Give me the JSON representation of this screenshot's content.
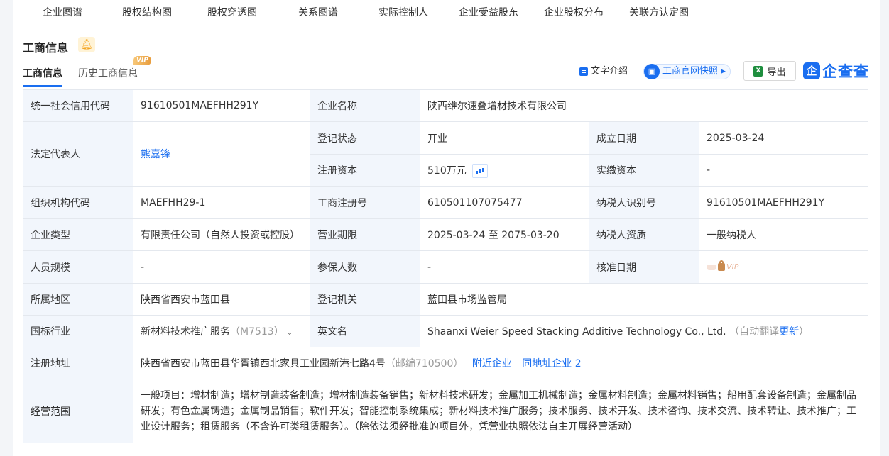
{
  "top_nav": [
    "企业图谱",
    "股权结构图",
    "股权穿透图",
    "关系图谱",
    "实际控制人",
    "企业受益股东",
    "企业股权分布",
    "关联方认定图"
  ],
  "section": {
    "title": "工商信息",
    "bell_icon": "bell-icon"
  },
  "tabs": {
    "active": "工商信息",
    "history": "历史工商信息",
    "vip": "VIP"
  },
  "toolbar": {
    "text_intro": "文字介绍",
    "snapshot": "工商官网快照",
    "export": "导出",
    "brand": "企查查",
    "brand_logo": "企"
  },
  "info": {
    "credit_code_label": "统一社会信用代码",
    "credit_code": "91610501MAEFHH291Y",
    "name_label": "企业名称",
    "name": "陕西维尔速叠增材技术有限公司",
    "legal_rep_label": "法定代表人",
    "legal_rep": "熊嘉锋",
    "reg_status_label": "登记状态",
    "reg_status": "开业",
    "est_date_label": "成立日期",
    "est_date": "2025-03-24",
    "reg_capital_label": "注册资本",
    "reg_capital": "510万元",
    "paid_capital_label": "实缴资本",
    "paid_capital": "-",
    "org_code_label": "组织机构代码",
    "org_code": "MAEFHH29-1",
    "biz_reg_no_label": "工商注册号",
    "biz_reg_no": "610501107075477",
    "taxpayer_id_label": "纳税人识别号",
    "taxpayer_id": "91610501MAEFHH291Y",
    "type_label": "企业类型",
    "type": "有限责任公司（自然人投资或控股）",
    "term_label": "营业期限",
    "term": "2025-03-24 至 2075-03-20",
    "tax_qual_label": "纳税人资质",
    "tax_qual": "一般纳税人",
    "staff_label": "人员规模",
    "staff": "-",
    "insured_label": "参保人数",
    "insured": "-",
    "approve_date_label": "核准日期",
    "approve_vip": "VIP",
    "region_label": "所属地区",
    "region": "陕西省西安市蓝田县",
    "authority_label": "登记机关",
    "authority": "蓝田县市场监管局",
    "industry_label": "国标行业",
    "industry": "新材料技术推广服务",
    "industry_code": "（M7513）",
    "en_name_label": "英文名",
    "en_name": "Shaanxi Weier Speed Stacking Additive Technology Co., Ltd.",
    "auto_translate": "（自动翻译",
    "update": "更新",
    "close_paren": "）",
    "address_label": "注册地址",
    "address": "陕西省西安市蓝田县华胥镇西北家具工业园新港七路4号",
    "postcode": "（邮编710500）",
    "nearby": "附近企业",
    "same_address": "同地址企业 2",
    "scope_label": "经营范围",
    "scope": "一般项目：增材制造；增材制造装备制造；增材制造装备销售；新材料技术研发；金属加工机械制造；金属材料制造；金属材料销售；船用配套设备制造；金属制品研发；有色金属铸造；金属制品销售；软件开发；智能控制系统集成；新材料技术推广服务；技术服务、技术开发、技术咨询、技术交流、技术转让、技术推广；工业设计服务；租赁服务（不含许可类租赁服务）。（除依法须经批准的项目外，凭营业执照依法自主开展经营活动）"
  }
}
